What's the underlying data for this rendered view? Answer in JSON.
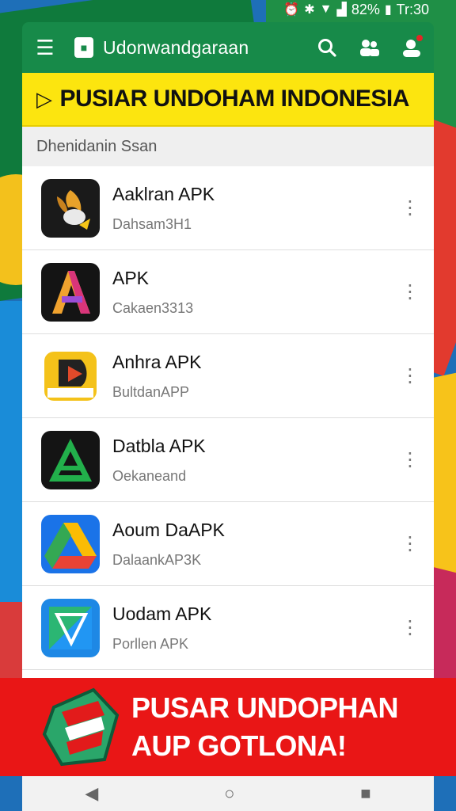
{
  "status_bar": {
    "battery": "82%",
    "time": "Tr:30"
  },
  "app_bar": {
    "title": "Udonwandgaraan"
  },
  "banner": {
    "text": "PUSIAR UNDOHAM INDONESIA"
  },
  "section": {
    "title": "Dhenidanin Ssan"
  },
  "apps": [
    {
      "name": "Aaklran APK",
      "sub": "Dahsam3H1",
      "icon": "dark-bird-app-icon"
    },
    {
      "name": "APK",
      "sub": "Cakaen3313",
      "icon": "letter-a-app-icon"
    },
    {
      "name": "Anhra APK",
      "sub": "BultdanAPP",
      "icon": "yellow-tag-app-icon"
    },
    {
      "name": "Datbla APK",
      "sub": "Oekaneand",
      "icon": "green-triangle-app-icon"
    },
    {
      "name": "Aoum DaAPK",
      "sub": "DalaankAP3K",
      "icon": "drive-triangle-app-icon"
    },
    {
      "name": "Uodam APK",
      "sub": "Porllen APK",
      "icon": "play-store-app-icon"
    }
  ],
  "promo": {
    "line1": "PUSAR UNDOPHAN",
    "line2": "AUP GOTLONA!"
  },
  "colors": {
    "appbar": "#178a49",
    "banner": "#fce50f",
    "promo": "#e91616"
  }
}
